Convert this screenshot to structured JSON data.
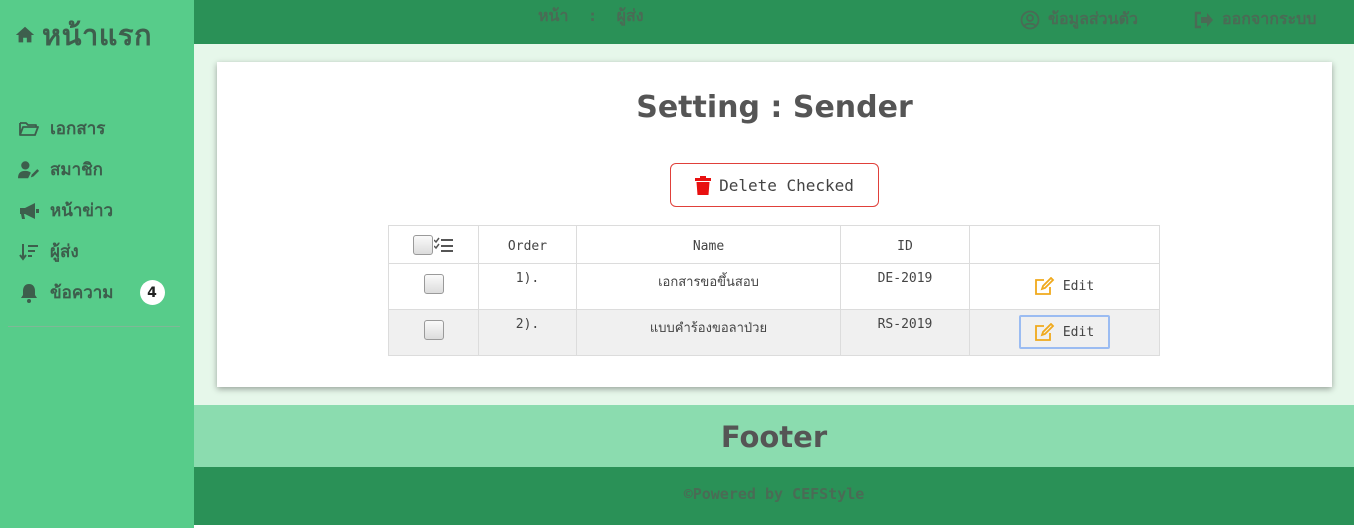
{
  "sidebar": {
    "brand": "หน้าแรก",
    "items": [
      {
        "label": "เอกสาร",
        "icon": "folder-open-icon"
      },
      {
        "label": "สมาชิก",
        "icon": "user-edit-icon"
      },
      {
        "label": "หน้าข่าว",
        "icon": "megaphone-icon"
      },
      {
        "label": "ผู้ส่ง",
        "icon": "sort-down-icon"
      },
      {
        "label": "ข้อความ",
        "icon": "bell-icon",
        "badge": "4"
      }
    ]
  },
  "topbar": {
    "breadcrumb": "หน้า  :  ผู้ส่ง",
    "profile_label": "ข้อมูลส่วนตัว",
    "logout_label": "ออกจากระบบ"
  },
  "main": {
    "title": "Setting : Sender",
    "delete_label": "Delete Checked",
    "table": {
      "headers": [
        "",
        "Order",
        "Name",
        "ID",
        ""
      ],
      "rows": [
        {
          "order": "1).",
          "name": "เอกสารขอขึ้นสอบ",
          "id": "DE-2019",
          "action": "Edit"
        },
        {
          "order": "2).",
          "name": "แบบคำร้องขอลาป่วย",
          "id": "RS-2019",
          "action": "Edit"
        }
      ]
    }
  },
  "footer": {
    "title": "Footer",
    "powered": "©Powered by CEFStyle"
  },
  "colors": {
    "sidebar": "#57cc8a",
    "topbar": "#2a9157",
    "content_bg": "#e6f7ea",
    "footer_band": "#8bdcaf",
    "delete_red": "#e0403a",
    "edit_orange": "#f0a91c"
  }
}
